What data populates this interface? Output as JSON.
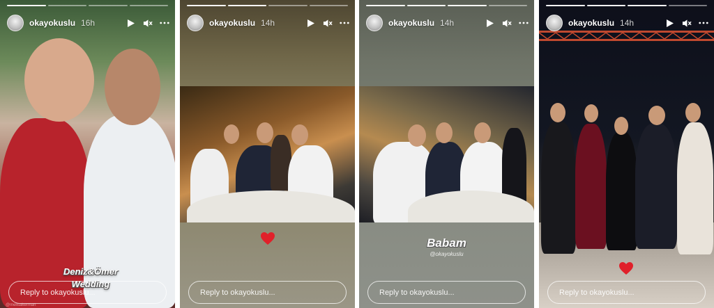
{
  "stories": [
    {
      "username": "okayokuslu",
      "time": "16h",
      "reply_placeholder": "Reply to okayokuslu...",
      "caption": "Deniz&Ömer Wedding",
      "watermark": "@melisakerman"
    },
    {
      "username": "okayokuslu",
      "time": "14h",
      "reply_placeholder": "Reply to okayokuslu...",
      "sticker": "heart"
    },
    {
      "username": "okayokuslu",
      "time": "14h",
      "reply_placeholder": "Reply to okayokuslu...",
      "caption": "Babam",
      "mention": "@okayokuslu"
    },
    {
      "username": "okayokuslu",
      "time": "14h",
      "reply_placeholder": "Reply to okayokuslu...",
      "sticker": "heart"
    }
  ],
  "icons": {
    "play": "play-icon",
    "mute": "mute-icon",
    "more": "more-icon"
  },
  "colors": {
    "heart": "#e0202a",
    "text": "#ffffff"
  }
}
